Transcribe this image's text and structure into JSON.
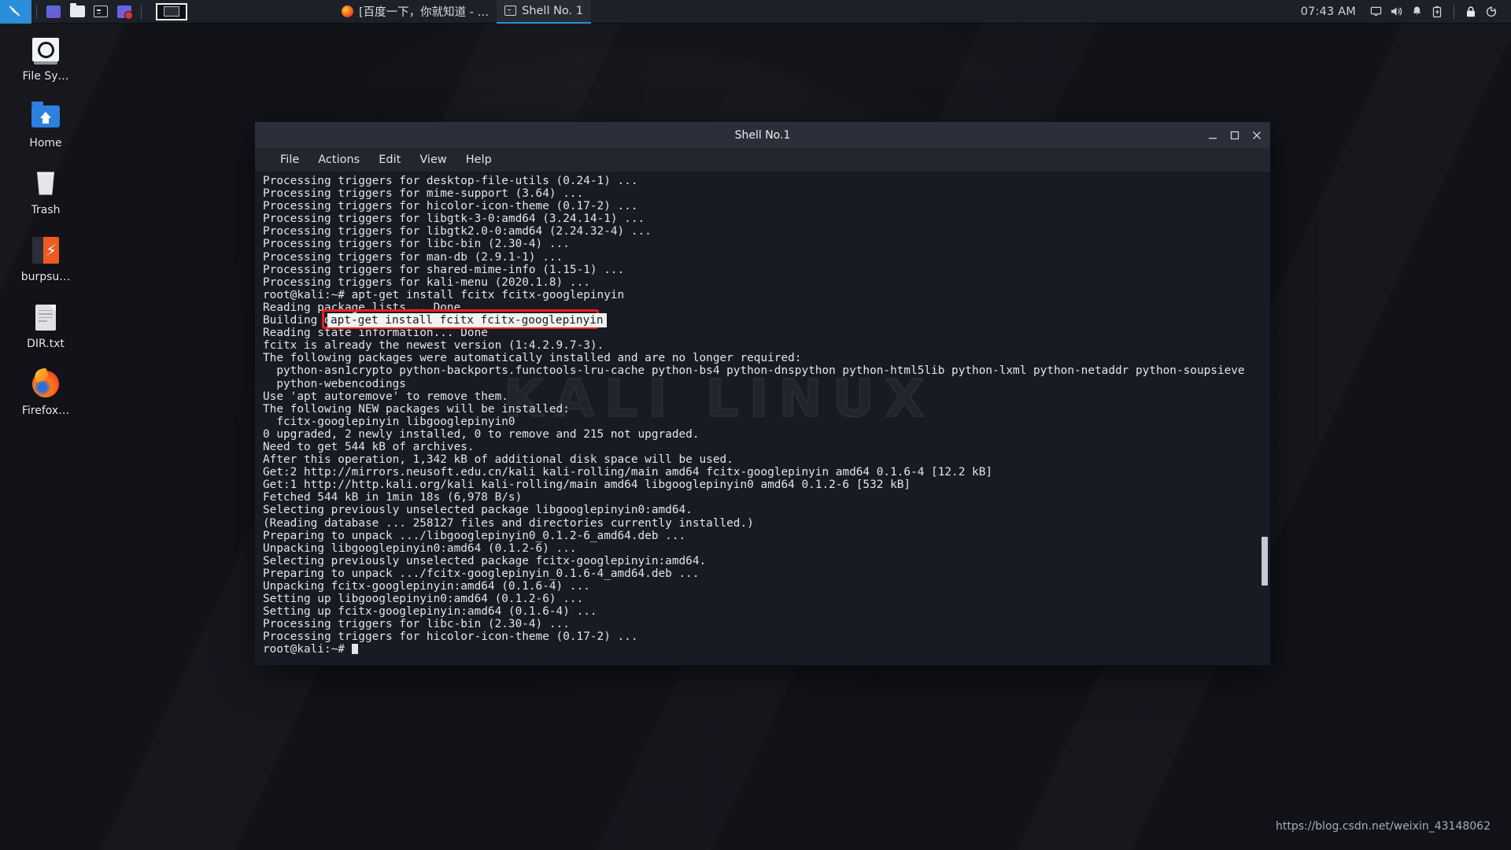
{
  "panel": {
    "menu_icon": "kali-dragon-icon",
    "launchers": [
      {
        "name": "file-manager-launcher",
        "icon": "files-icon"
      },
      {
        "name": "folder-launcher",
        "icon": "folder-icon"
      },
      {
        "name": "terminal-launcher",
        "icon": "terminal-icon"
      },
      {
        "name": "screen-recorder-launcher",
        "icon": "record-icon"
      }
    ],
    "workspace_label": "workspace-switcher",
    "tasks": [
      {
        "name": "taskbar-item-firefox",
        "icon": "firefox-icon",
        "label": "[百度一下，你就知道 - …",
        "active": false
      },
      {
        "name": "taskbar-item-shell",
        "icon": "terminal-icon",
        "label": "Shell No. 1",
        "active": true
      }
    ],
    "clock": "07:43 AM",
    "tray": [
      {
        "name": "display-icon",
        "icon": "monitor-icon"
      },
      {
        "name": "volume-icon",
        "icon": "speaker-icon"
      },
      {
        "name": "notifications-icon",
        "icon": "bell-icon"
      },
      {
        "name": "battery-icon",
        "icon": "battery-icon"
      },
      {
        "name": "lock-icon",
        "icon": "padlock-icon"
      },
      {
        "name": "logout-icon",
        "icon": "power-icon"
      }
    ]
  },
  "desktop": {
    "icons": [
      {
        "name": "desktop-icon-filesystem",
        "label": "File Sy…",
        "glyph": "filesystem-icon"
      },
      {
        "name": "desktop-icon-home",
        "label": "Home",
        "glyph": "home-folder-icon"
      },
      {
        "name": "desktop-icon-trash",
        "label": "Trash",
        "glyph": "trash-icon"
      },
      {
        "name": "desktop-icon-burpsuite",
        "label": "burpsu…",
        "glyph": "burpsuite-icon"
      },
      {
        "name": "desktop-icon-dir-txt",
        "label": "DIR.txt",
        "glyph": "text-file-icon"
      },
      {
        "name": "desktop-icon-firefox",
        "label": "Firefox…",
        "glyph": "firefox-icon"
      }
    ]
  },
  "terminal": {
    "title": "Shell No.1",
    "watermark": "KALI LINUX",
    "menu": [
      "File",
      "Actions",
      "Edit",
      "View",
      "Help"
    ],
    "window_buttons": [
      "minimize",
      "maximize",
      "close"
    ],
    "annotation": {
      "highlighted_command": "apt-get install fcitx fcitx-googlepinyin",
      "box_color": "#f01c1c"
    },
    "lines": [
      "Processing triggers for desktop-file-utils (0.24-1) ...",
      "Processing triggers for mime-support (3.64) ...",
      "Processing triggers for hicolor-icon-theme (0.17-2) ...",
      "Processing triggers for libgtk-3-0:amd64 (3.24.14-1) ...",
      "Processing triggers for libgtk2.0-0:amd64 (2.24.32-4) ...",
      "Processing triggers for libc-bin (2.30-4) ...",
      "Processing triggers for man-db (2.9.1-1) ...",
      "Processing triggers for shared-mime-info (1.15-1) ...",
      "Processing triggers for kali-menu (2020.1.8) ...",
      "root@kali:~# apt-get install fcitx fcitx-googlepinyin",
      "Reading package lists... Done",
      "Building dependency tree",
      "Reading state information... Done",
      "fcitx is already the newest version (1:4.2.9.7-3).",
      "The following packages were automatically installed and are no longer required:",
      "  python-asn1crypto python-backports.functools-lru-cache python-bs4 python-dnspython python-html5lib python-lxml python-netaddr python-soupsieve",
      "  python-webencodings",
      "Use 'apt autoremove' to remove them.",
      "The following NEW packages will be installed:",
      "  fcitx-googlepinyin libgooglepinyin0",
      "0 upgraded, 2 newly installed, 0 to remove and 215 not upgraded.",
      "Need to get 544 kB of archives.",
      "After this operation, 1,342 kB of additional disk space will be used.",
      "Get:2 http://mirrors.neusoft.edu.cn/kali kali-rolling/main amd64 fcitx-googlepinyin amd64 0.1.6-4 [12.2 kB]",
      "Get:1 http://http.kali.org/kali kali-rolling/main amd64 libgooglepinyin0 amd64 0.1.2-6 [532 kB]",
      "Fetched 544 kB in 1min 18s (6,978 B/s)",
      "Selecting previously unselected package libgooglepinyin0:amd64.",
      "(Reading database ... 258127 files and directories currently installed.)",
      "Preparing to unpack .../libgooglepinyin0_0.1.2-6_amd64.deb ...",
      "Unpacking libgooglepinyin0:amd64 (0.1.2-6) ...",
      "Selecting previously unselected package fcitx-googlepinyin:amd64.",
      "Preparing to unpack .../fcitx-googlepinyin_0.1.6-4_amd64.deb ...",
      "Unpacking fcitx-googlepinyin:amd64 (0.1.6-4) ...",
      "Setting up libgooglepinyin0:amd64 (0.1.2-6) ...",
      "Setting up fcitx-googlepinyin:amd64 (0.1.6-4) ...",
      "Processing triggers for libc-bin (2.30-4) ...",
      "Processing triggers for hicolor-icon-theme (0.17-2) ...",
      "root@kali:~# "
    ]
  },
  "watermark": {
    "text": "https://blog.csdn.net/weixin_43148062"
  }
}
